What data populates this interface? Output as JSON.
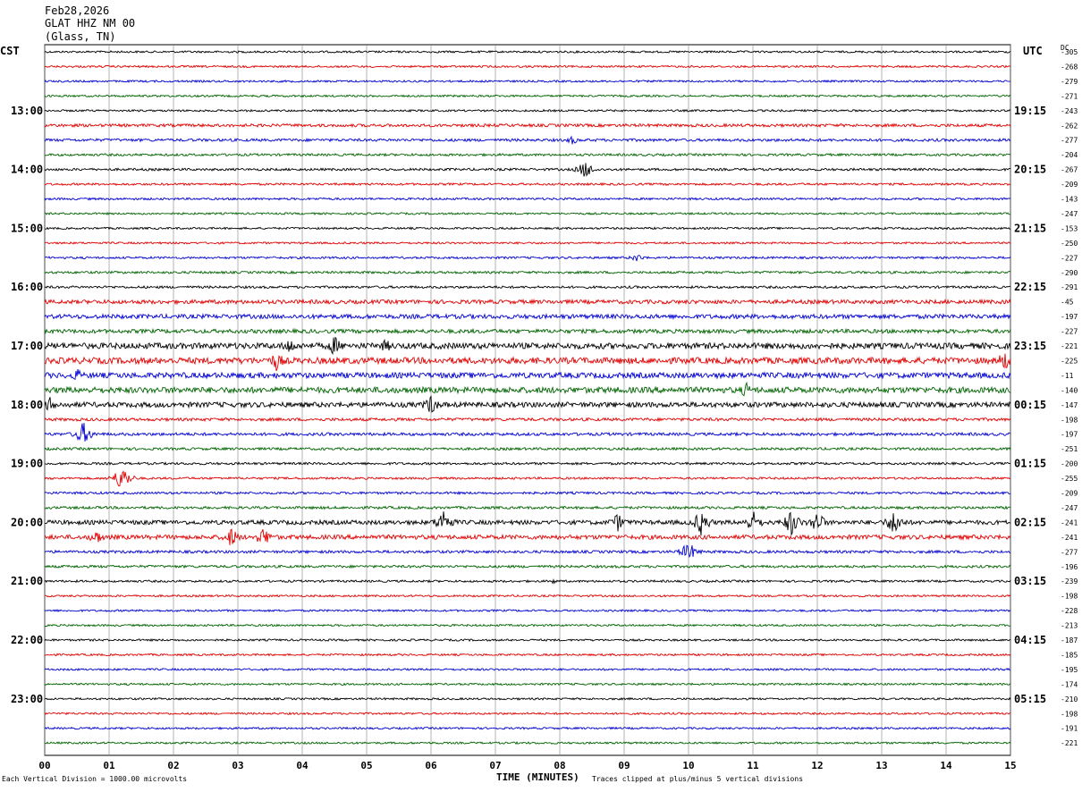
{
  "header": {
    "date": "Feb28,2026",
    "station": "GLAT HHZ NM 00",
    "location": "(Glass, TN)"
  },
  "left_axis_label": "CST",
  "right_axis_label": "UTC",
  "dc_label": "DC",
  "footer": {
    "left": "Each Vertical Division = 1000.00 microvolts",
    "center": "TIME (MINUTES)",
    "right": "Traces clipped at plus/minus 5 vertical divisions"
  },
  "colors": {
    "trace_cycle": [
      "#000000",
      "#e00000",
      "#0000d0",
      "#006400"
    ],
    "grid": "#808080"
  },
  "chart_data": {
    "type": "line",
    "title": "Feb28,2026 GLAT HHZ NM 00 (Glass, TN)",
    "xlabel": "TIME (MINUTES)",
    "xlim": [
      0,
      15
    ],
    "x_ticks": [
      "00",
      "01",
      "02",
      "03",
      "04",
      "05",
      "06",
      "07",
      "08",
      "09",
      "10",
      "11",
      "12",
      "13",
      "14",
      "15"
    ],
    "trace_minutes": 15,
    "grid": true,
    "left_time_labels": [
      {
        "trace": 4,
        "label": "13:00"
      },
      {
        "trace": 8,
        "label": "14:00"
      },
      {
        "trace": 12,
        "label": "15:00"
      },
      {
        "trace": 16,
        "label": "16:00"
      },
      {
        "trace": 20,
        "label": "17:00"
      },
      {
        "trace": 24,
        "label": "18:00"
      },
      {
        "trace": 28,
        "label": "19:00"
      },
      {
        "trace": 32,
        "label": "20:00"
      },
      {
        "trace": 36,
        "label": "21:00"
      },
      {
        "trace": 40,
        "label": "22:00"
      },
      {
        "trace": 44,
        "label": "23:00"
      }
    ],
    "right_time_labels": [
      {
        "trace": 4,
        "label": "19:15"
      },
      {
        "trace": 8,
        "label": "20:15"
      },
      {
        "trace": 12,
        "label": "21:15"
      },
      {
        "trace": 16,
        "label": "22:15"
      },
      {
        "trace": 20,
        "label": "23:15"
      },
      {
        "trace": 24,
        "label": "00:15"
      },
      {
        "trace": 28,
        "label": "01:15"
      },
      {
        "trace": 32,
        "label": "02:15"
      },
      {
        "trace": 36,
        "label": "03:15"
      },
      {
        "trace": 40,
        "label": "04:15"
      },
      {
        "trace": 44,
        "label": "05:15"
      }
    ],
    "dc_offsets": [
      -305,
      -268,
      -279,
      -271,
      -243,
      -262,
      -277,
      -204,
      -267,
      -209,
      -143,
      -247,
      -153,
      -250,
      -227,
      -290,
      -291,
      -45,
      -197,
      -227,
      -221,
      -225,
      -11,
      -140,
      -147,
      -198,
      -197,
      -251,
      -200,
      -255,
      -209,
      -247,
      -241,
      -241,
      -277,
      -196,
      -239,
      -198,
      -228,
      -213,
      -187,
      -185,
      -195,
      -174,
      -210,
      -198,
      -191,
      -221
    ],
    "trace_activity": [
      1,
      1,
      1,
      1,
      1,
      1.5,
      1.4,
      1.2,
      1.2,
      1.1,
      1.1,
      1,
      1,
      1,
      1.1,
      1.2,
      1.2,
      2,
      2.2,
      2,
      3,
      3.2,
      2.8,
      3,
      2.6,
      1.5,
      1.5,
      1.3,
      1.2,
      1.1,
      1.2,
      1.3,
      2.2,
      2.2,
      1.4,
      1.3,
      1.1,
      1,
      1,
      1,
      1,
      1,
      1,
      1,
      1,
      1,
      1,
      1
    ],
    "events": [
      {
        "trace": 8,
        "minute": 8.4,
        "amplitude": 11
      },
      {
        "trace": 6,
        "minute": 8.2,
        "amplitude": 5
      },
      {
        "trace": 14,
        "minute": 9.2,
        "amplitude": 5
      },
      {
        "trace": 20,
        "minute": 3.8,
        "amplitude": 10
      },
      {
        "trace": 20,
        "minute": 4.5,
        "amplitude": 12
      },
      {
        "trace": 20,
        "minute": 5.3,
        "amplitude": 8
      },
      {
        "trace": 21,
        "minute": 3.6,
        "amplitude": 12
      },
      {
        "trace": 21,
        "minute": 14.9,
        "amplitude": 12
      },
      {
        "trace": 22,
        "minute": 0.5,
        "amplitude": 8
      },
      {
        "trace": 23,
        "minute": 10.9,
        "amplitude": 9
      },
      {
        "trace": 24,
        "minute": 0.1,
        "amplitude": 10
      },
      {
        "trace": 24,
        "minute": 6.0,
        "amplitude": 12
      },
      {
        "trace": 26,
        "minute": 0.6,
        "amplitude": 14
      },
      {
        "trace": 29,
        "minute": 1.2,
        "amplitude": 16
      },
      {
        "trace": 32,
        "minute": 6.2,
        "amplitude": 16
      },
      {
        "trace": 32,
        "minute": 8.9,
        "amplitude": 11
      },
      {
        "trace": 32,
        "minute": 10.2,
        "amplitude": 16
      },
      {
        "trace": 32,
        "minute": 11.0,
        "amplitude": 14
      },
      {
        "trace": 32,
        "minute": 11.6,
        "amplitude": 16
      },
      {
        "trace": 32,
        "minute": 12.0,
        "amplitude": 14
      },
      {
        "trace": 32,
        "minute": 13.2,
        "amplitude": 16
      },
      {
        "trace": 33,
        "minute": 0.8,
        "amplitude": 9
      },
      {
        "trace": 33,
        "minute": 2.9,
        "amplitude": 12
      },
      {
        "trace": 33,
        "minute": 3.4,
        "amplitude": 12
      },
      {
        "trace": 34,
        "minute": 10.0,
        "amplitude": 12
      },
      {
        "trace": 36,
        "minute": 7.9,
        "amplitude": 3
      }
    ]
  }
}
